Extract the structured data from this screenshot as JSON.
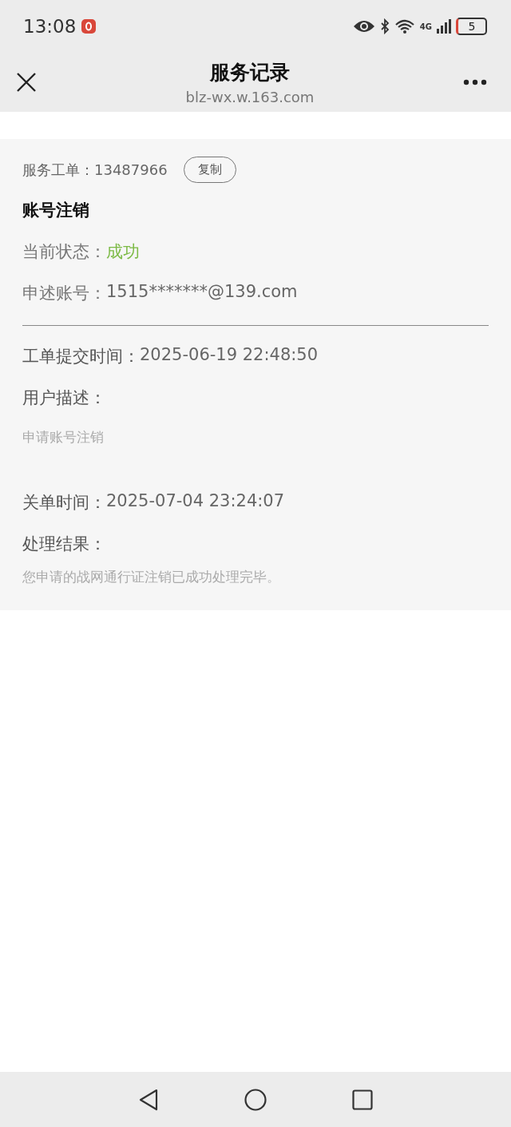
{
  "status_bar": {
    "time": "13:08",
    "network": "4G",
    "battery": "5"
  },
  "header": {
    "title": "服务记录",
    "url": "blz-wx.w.163.com"
  },
  "ticket": {
    "label": "服务工单：",
    "number": "13487966",
    "copy_button": "复制"
  },
  "title": "账号注销",
  "fields": [
    {
      "kind": "status",
      "label": "当前状态：",
      "value": "成功"
    },
    {
      "kind": "plain",
      "label": "申述账号：",
      "value": "1515*******@139.com"
    }
  ],
  "submit_time": {
    "label": "工单提交时间：",
    "value": "2025-06-19 22:48:50"
  },
  "description": {
    "label": "用户描述：",
    "text": "申请账号注销"
  },
  "close_time": {
    "label": "关单时间：",
    "value": "2025-07-04 23:24:07"
  },
  "result": {
    "label": "处理结果：",
    "text": "您申请的战网通行证注销已成功处理完毕。"
  }
}
